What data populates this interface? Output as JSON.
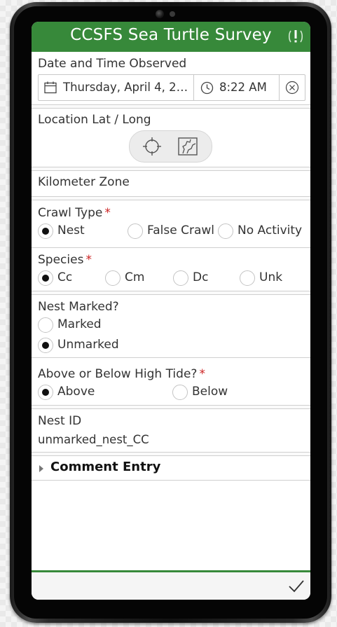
{
  "app": {
    "title": "CCSFS Sea Turtle Survey",
    "accent_color": "#37893a",
    "alert_icon": "alert-icon"
  },
  "fields": {
    "datetime": {
      "label": "Date and Time Observed",
      "date_value": "Thursday, April 4, 2…",
      "time_value": "8:22 AM",
      "date_icon": "calendar-icon",
      "time_icon": "clock-icon",
      "clear_icon": "clear-icon"
    },
    "location": {
      "label": "Location Lat / Long",
      "gps_icon": "crosshair-icon",
      "map_icon": "map-icon"
    },
    "km_zone": {
      "label": "Kilometer Zone"
    },
    "crawl_type": {
      "label": "Crawl Type",
      "required": "*",
      "options": [
        "Nest",
        "False Crawl",
        "No Activity"
      ],
      "selected": "Nest"
    },
    "species": {
      "label": "Species",
      "required": "*",
      "options": [
        "Cc",
        "Cm",
        "Dc",
        "Unk"
      ],
      "selected": "Cc"
    },
    "nest_marked": {
      "label": "Nest Marked?",
      "options": [
        "Marked",
        "Unmarked"
      ],
      "selected": "Unmarked"
    },
    "high_tide": {
      "label": "Above or Below High Tide?",
      "required": "*",
      "options": [
        "Above",
        "Below"
      ],
      "selected": "Above"
    },
    "nest_id": {
      "label": "Nest ID",
      "value": "unmarked_nest_CC"
    }
  },
  "groups": {
    "comment": {
      "label": "Comment Entry",
      "icon": "expand-triangle-icon"
    }
  },
  "footer": {
    "submit_icon": "checkmark-icon"
  }
}
